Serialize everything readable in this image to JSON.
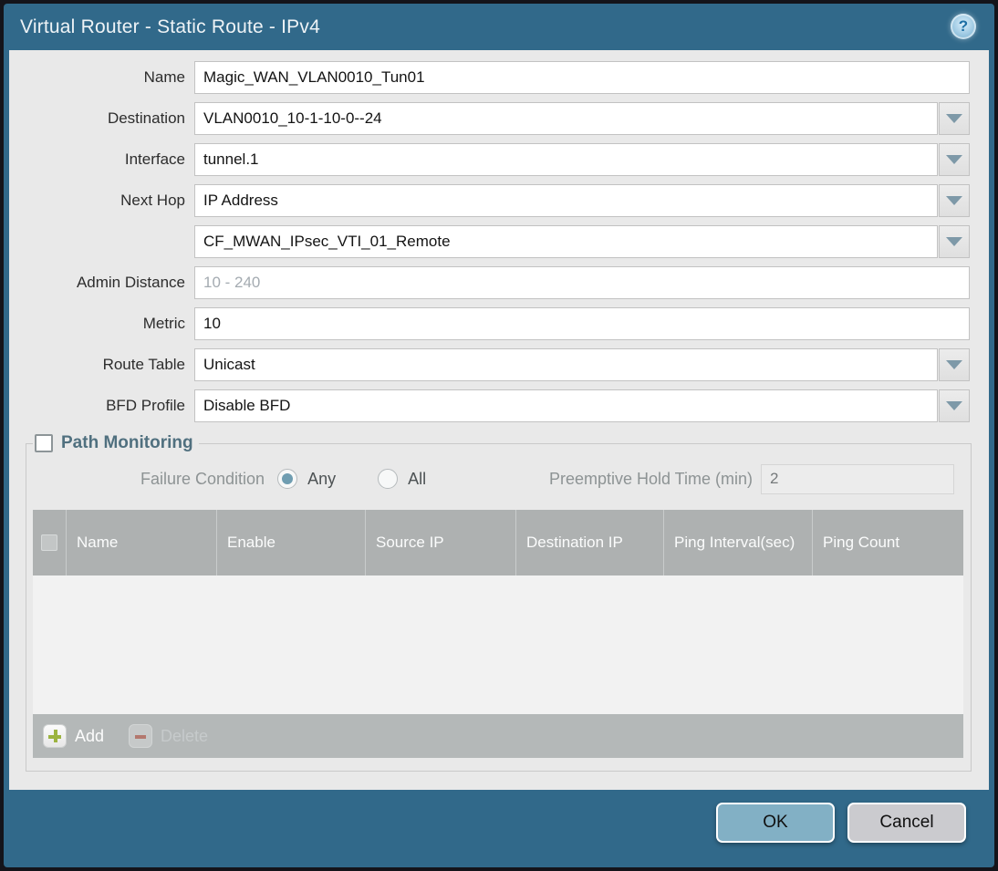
{
  "dialog": {
    "title": "Virtual Router - Static Route - IPv4",
    "help_icon": "?"
  },
  "form": {
    "name": {
      "label": "Name",
      "value": "Magic_WAN_VLAN0010_Tun01"
    },
    "destination": {
      "label": "Destination",
      "value": "VLAN0010_10-1-10-0--24"
    },
    "interface": {
      "label": "Interface",
      "value": "tunnel.1"
    },
    "next_hop": {
      "label": "Next Hop",
      "value": "IP Address"
    },
    "next_hop_ip": {
      "value": "CF_MWAN_IPsec_VTI_01_Remote"
    },
    "admin_distance": {
      "label": "Admin Distance",
      "placeholder": "10 - 240"
    },
    "metric": {
      "label": "Metric",
      "value": "10"
    },
    "route_table": {
      "label": "Route Table",
      "value": "Unicast"
    },
    "bfd_profile": {
      "label": "BFD Profile",
      "value": "Disable BFD"
    }
  },
  "path_monitoring": {
    "title": "Path Monitoring",
    "enabled": false,
    "failure_condition_label": "Failure Condition",
    "option_any": "Any",
    "option_all": "All",
    "selected_option": "Any",
    "preemptive_label": "Preemptive Hold Time (min)",
    "preemptive_value": "2",
    "columns": [
      "Name",
      "Enable",
      "Source IP",
      "Destination IP",
      "Ping Interval(sec)",
      "Ping Count"
    ],
    "rows": [],
    "add_label": "Add",
    "delete_label": "Delete"
  },
  "actions": {
    "ok": "OK",
    "cancel": "Cancel"
  },
  "colors": {
    "titlebar_teal": "#31698a",
    "content_gray": "#e9e9e9",
    "table_header_gray": "#aeb1b1",
    "ok_button_blue": "#82b0c5",
    "cancel_button_gray": "#cbcbcf",
    "add_icon_green": "#9cb440",
    "delete_icon_red": "#b3786e",
    "radio_selected_blue": "#6f9db1"
  }
}
